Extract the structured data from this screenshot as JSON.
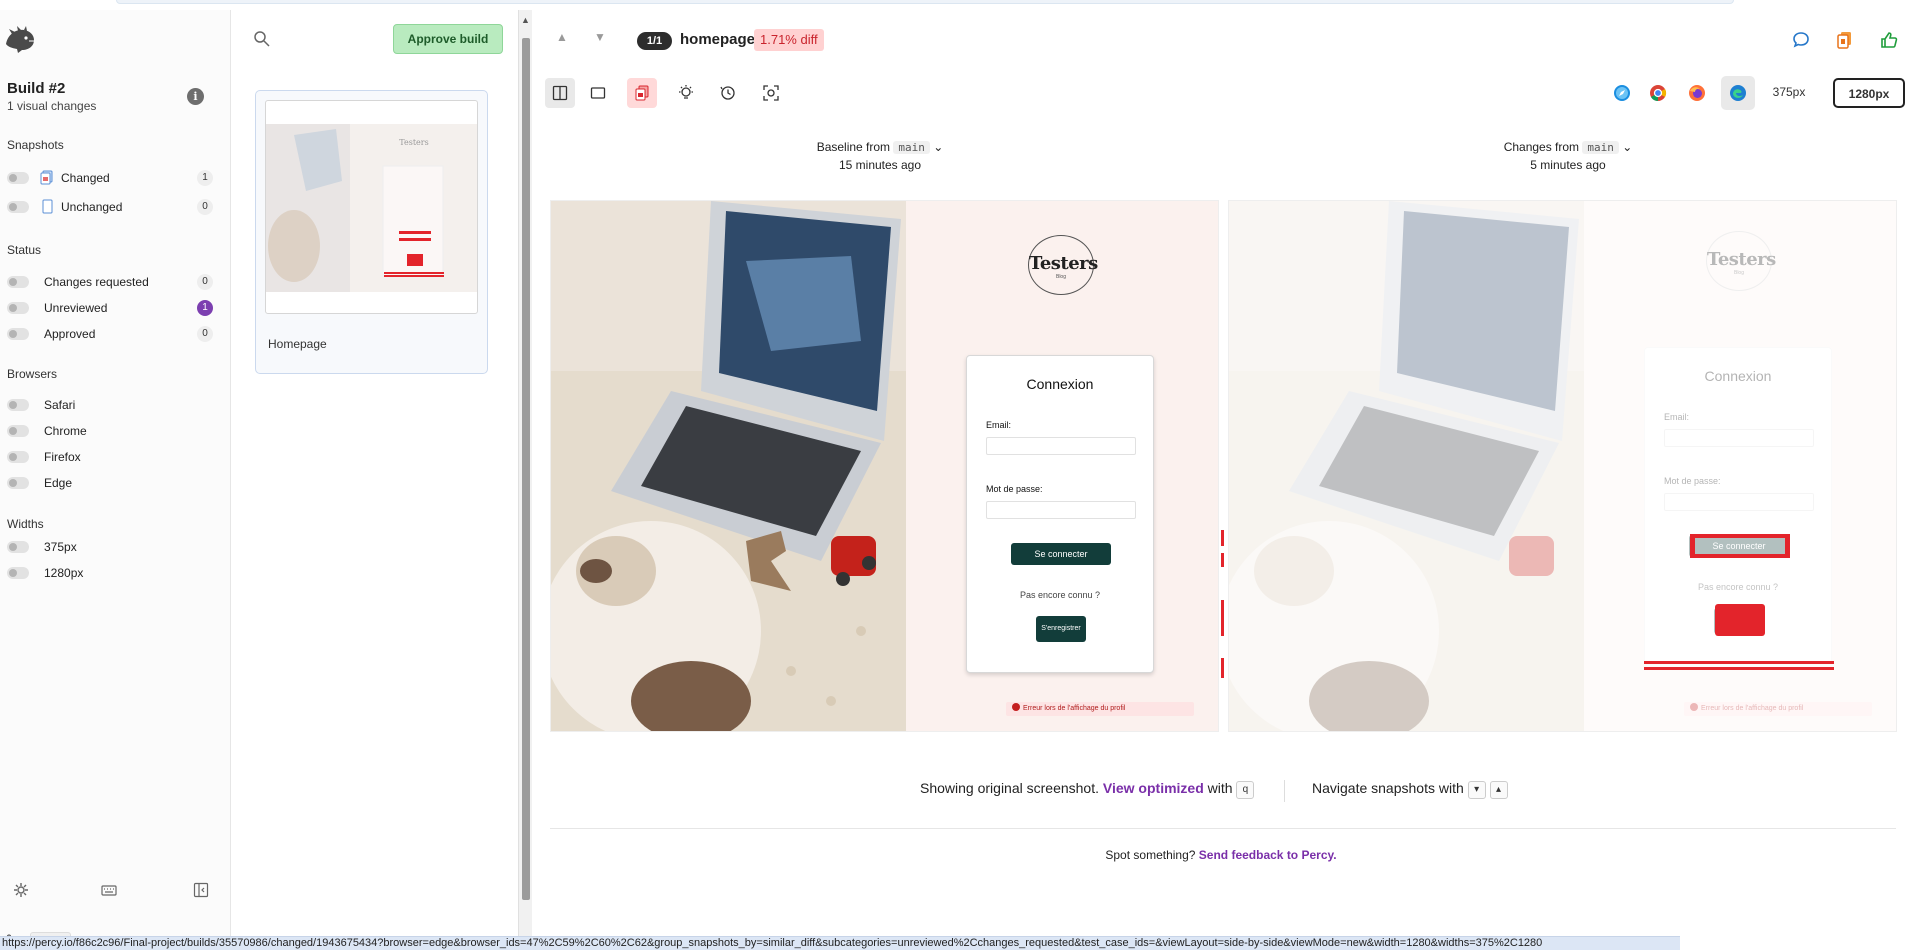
{
  "build": {
    "title": "Build #2",
    "subtitle": "1 visual changes"
  },
  "filters": {
    "snapshots_heading": "Snapshots",
    "snapshots": [
      {
        "label": "Changed",
        "count": "1"
      },
      {
        "label": "Unchanged",
        "count": "0"
      }
    ],
    "status_heading": "Status",
    "status": [
      {
        "label": "Changes requested",
        "count": "0"
      },
      {
        "label": "Unreviewed",
        "count": "1"
      },
      {
        "label": "Approved",
        "count": "0"
      }
    ],
    "browsers_heading": "Browsers",
    "browsers": [
      "Safari",
      "Chrome",
      "Firefox",
      "Edge"
    ],
    "widths_heading": "Widths",
    "widths": [
      "375px",
      "1280px"
    ]
  },
  "branch": "main",
  "snapshot_list": {
    "approve_label": "Approve build",
    "card_label": "Homepage"
  },
  "header": {
    "position": "1/1",
    "name": "homepage",
    "diff": "1.71% diff"
  },
  "width_options": [
    "375px",
    "1280px"
  ],
  "baseline": {
    "prefix": "Baseline from",
    "branch": "main",
    "time": "15 minutes ago"
  },
  "changes": {
    "prefix": "Changes from",
    "branch": "main",
    "time": "5 minutes ago"
  },
  "site": {
    "brand": "Testers",
    "brand_sub": "Blog",
    "login_title": "Connexion",
    "email_label": "Email:",
    "password_label": "Mot de passe:",
    "login_button": "Se connecter",
    "register_question": "Pas encore connu ?",
    "register_button": "S'enregistrer",
    "error": "Erreur lors de l'affichage du profil"
  },
  "footer": {
    "showing": "Showing original screenshot.",
    "view_optimized": "View optimized",
    "with": "with",
    "key_q": "q",
    "navigate": "Navigate snapshots with",
    "key_down": "▾",
    "key_up": "▴",
    "spot": "Spot something?",
    "feedback": "Send feedback to Percy."
  },
  "status_url": "https://percy.io/f86c2c96/Final-project/builds/35570986/changed/1943675434?browser=edge&browser_ids=47%2C59%2C60%2C62&group_snapshots_by=similar_diff&subcategories=unreviewed%2Cchanges_requested&test_case_ids=&viewLayout=side-by-side&viewMode=new&width=1280&widths=375%2C1280",
  "colors": {
    "accent_purple": "#7c3fb0",
    "approve_green": "#b9ebbf",
    "diff_red": "#e3242b",
    "button_dark_teal": "#123d3a"
  }
}
